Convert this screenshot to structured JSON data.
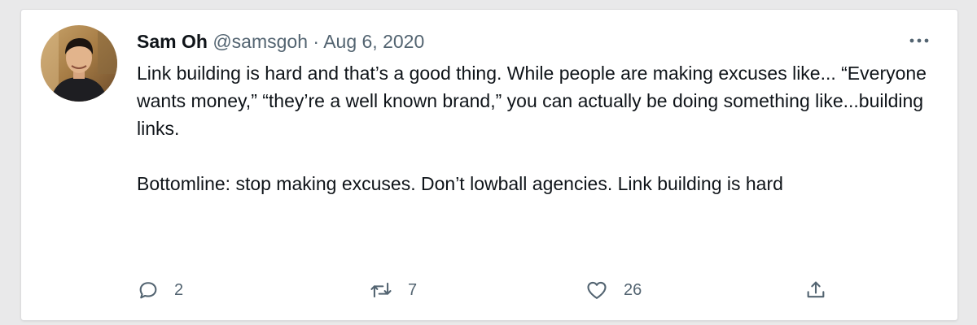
{
  "tweet": {
    "author_name": "Sam Oh",
    "handle": "@samsgoh",
    "separator": "·",
    "date": "Aug 6, 2020",
    "text": "Link building is hard and that’s a good thing. While people are making excuses like... “Everyone wants money,” “they’re a well known brand,” you can actually be doing something like...building links.\n\nBottomline: stop making excuses. Don’t lowball agencies. Link building is hard"
  },
  "actions": {
    "reply_count": "2",
    "retweet_count": "7",
    "like_count": "26"
  },
  "icons": {
    "more": "more-horizontal-icon",
    "reply": "reply-bubble-icon",
    "retweet": "retweet-icon",
    "like": "heart-icon",
    "share": "share-upload-icon"
  },
  "colors": {
    "text_primary": "#0f1419",
    "text_secondary": "#536471",
    "card_background": "#ffffff"
  }
}
